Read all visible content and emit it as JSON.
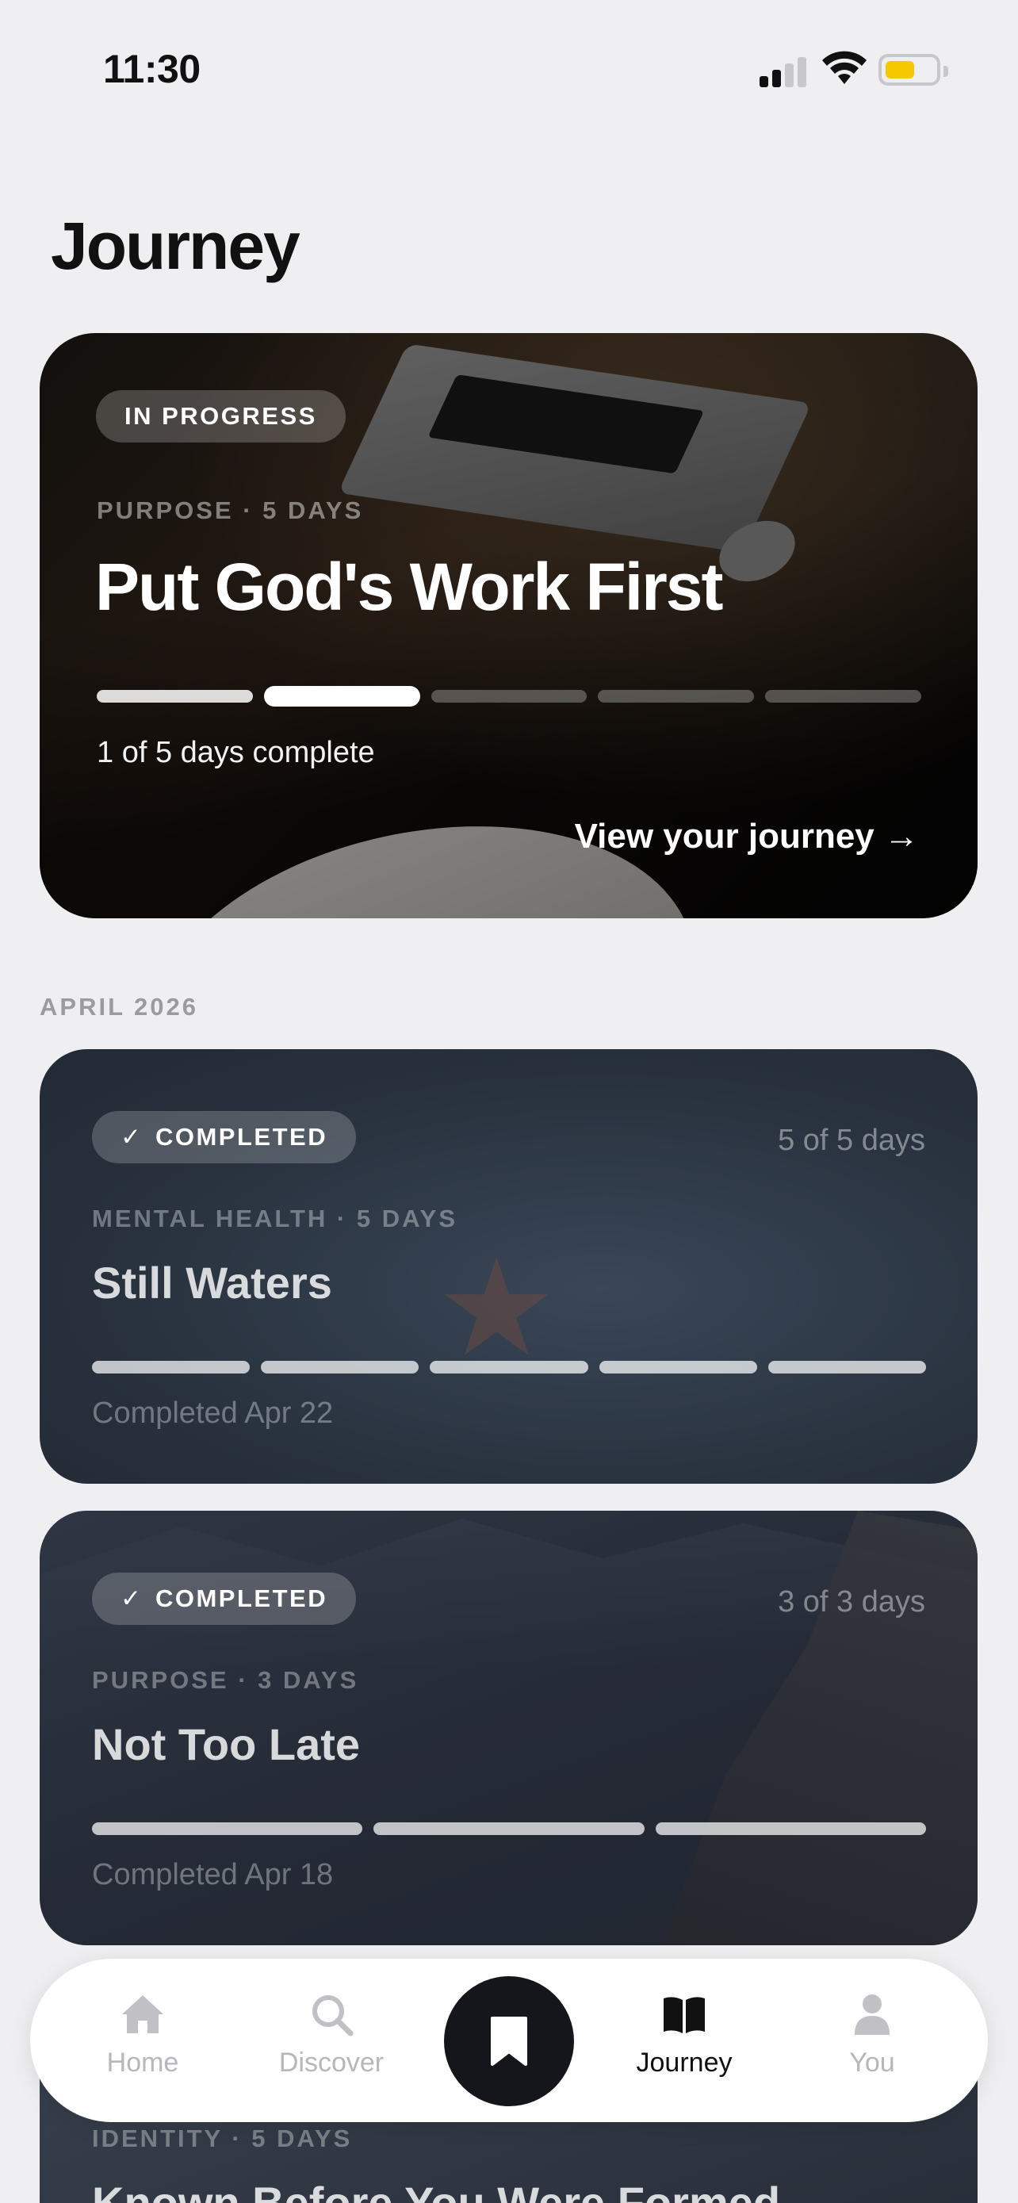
{
  "status_bar": {
    "time": "11:30"
  },
  "page": {
    "title": "Journey"
  },
  "hero": {
    "badge": "IN PROGRESS",
    "meta": "PURPOSE · 5 DAYS",
    "title": "Put God's Work First",
    "progress": {
      "completed_days": 1,
      "current_day": 2,
      "total_days": 5
    },
    "progress_label": "1 of 5 days complete",
    "cta": "View your journey →"
  },
  "section": {
    "label": "APRIL 2026"
  },
  "completed": [
    {
      "badge": "COMPLETED",
      "check": "✓",
      "days": "5 of 5 days",
      "meta": "MENTAL HEALTH · 5 DAYS",
      "title": "Still Waters",
      "total_days": 5,
      "completed_label": "Completed Apr 22"
    },
    {
      "badge": "COMPLETED",
      "check": "✓",
      "days": "3 of 3 days",
      "meta": "PURPOSE · 3 DAYS",
      "title": "Not Too Late",
      "total_days": 3,
      "completed_label": "Completed Apr 18"
    }
  ],
  "partial_card": {
    "meta": "IDENTITY · 5 DAYS",
    "title": "Known Before You Were Formed"
  },
  "nav": {
    "items": [
      {
        "label": "Home",
        "icon": "home-icon"
      },
      {
        "label": "Discover",
        "icon": "search-icon"
      },
      {
        "label": "Journey",
        "icon": "book-icon",
        "active": true
      },
      {
        "label": "You",
        "icon": "person-icon"
      }
    ],
    "center_icon": "bookmark-icon"
  },
  "colors": {
    "accent": "#15151c",
    "battery": "#f5c800",
    "inactive": "#b6b6bb",
    "background": "#efeff2"
  }
}
